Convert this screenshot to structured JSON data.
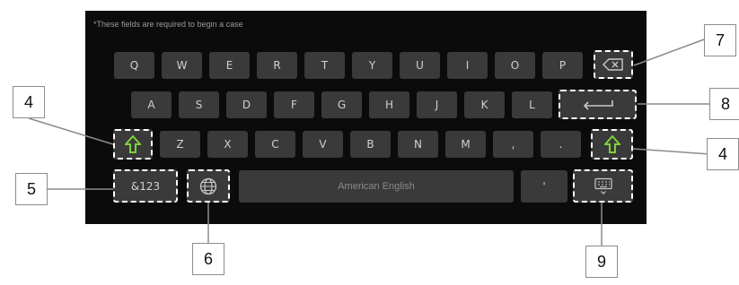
{
  "note": "*These fields are required to begin a case",
  "rows": {
    "row1": [
      "Q",
      "W",
      "E",
      "R",
      "T",
      "Y",
      "U",
      "I",
      "O",
      "P"
    ],
    "row2": [
      "A",
      "S",
      "D",
      "F",
      "G",
      "H",
      "J",
      "K",
      "L"
    ],
    "row3": [
      "Z",
      "X",
      "C",
      "V",
      "B",
      "N",
      "M",
      ",",
      "."
    ]
  },
  "bottom": {
    "symbols_label": "&123",
    "space_label": "American English",
    "apostrophe_label": "'"
  },
  "icons": {
    "backspace": "backspace-icon",
    "enter": "enter-icon",
    "shift": "shift-icon",
    "globe": "globe-icon",
    "hide_keyboard": "keyboard-hide-icon"
  },
  "callouts": {
    "shift_left": "4",
    "symbols": "5",
    "globe": "6",
    "backspace": "7",
    "enter": "8",
    "shift_right": "4",
    "hide": "9"
  },
  "colors": {
    "panel": "#0b0b0b",
    "key": "#3a3a3a",
    "shift_accent": "#7fd13b",
    "highlight_border": "#ffffff"
  }
}
